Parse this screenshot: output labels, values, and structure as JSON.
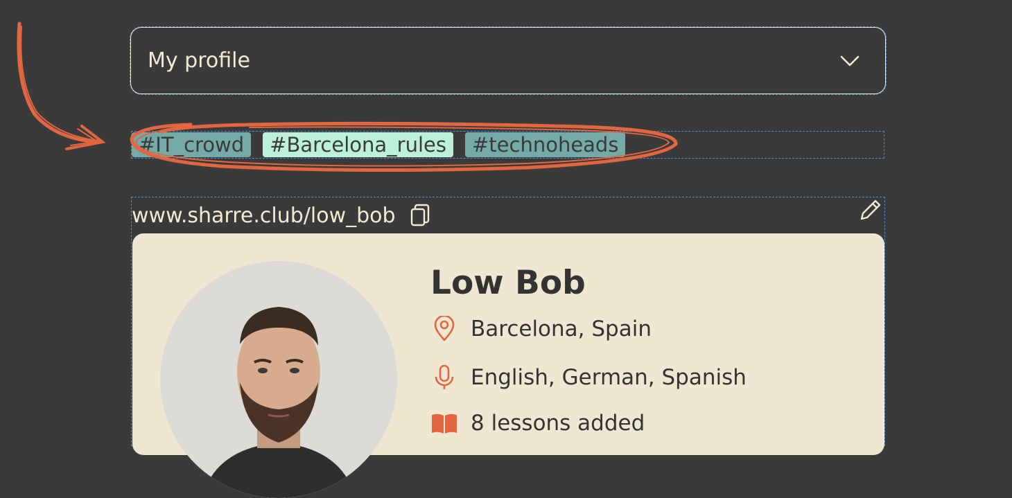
{
  "profile_select": {
    "label": "My profile"
  },
  "tags": [
    {
      "text": "#IT_crowd",
      "bg": "#74aba8"
    },
    {
      "text": "#Barcelona_rules",
      "bg": "#bdf0d8"
    },
    {
      "text": "#technoheads",
      "bg": "#74aba8"
    }
  ],
  "profile_link": "www.sharre.club/low_bob",
  "card": {
    "name": "Low Bob",
    "location": "Barcelona, Spain",
    "languages": "English, German, Spanish",
    "lessons": "8 lessons added"
  },
  "icons": {
    "dropdown": "chevron-down-icon",
    "copy": "copy-icon",
    "edit": "pencil-icon",
    "location": "map-pin-icon",
    "languages": "microphone-icon",
    "lessons": "book-icon"
  },
  "colors": {
    "background": "#3a3a3a",
    "accent": "#e2663f",
    "card": "#efe7d2",
    "text_light": "#f3ead6",
    "text_dark": "#333333"
  }
}
